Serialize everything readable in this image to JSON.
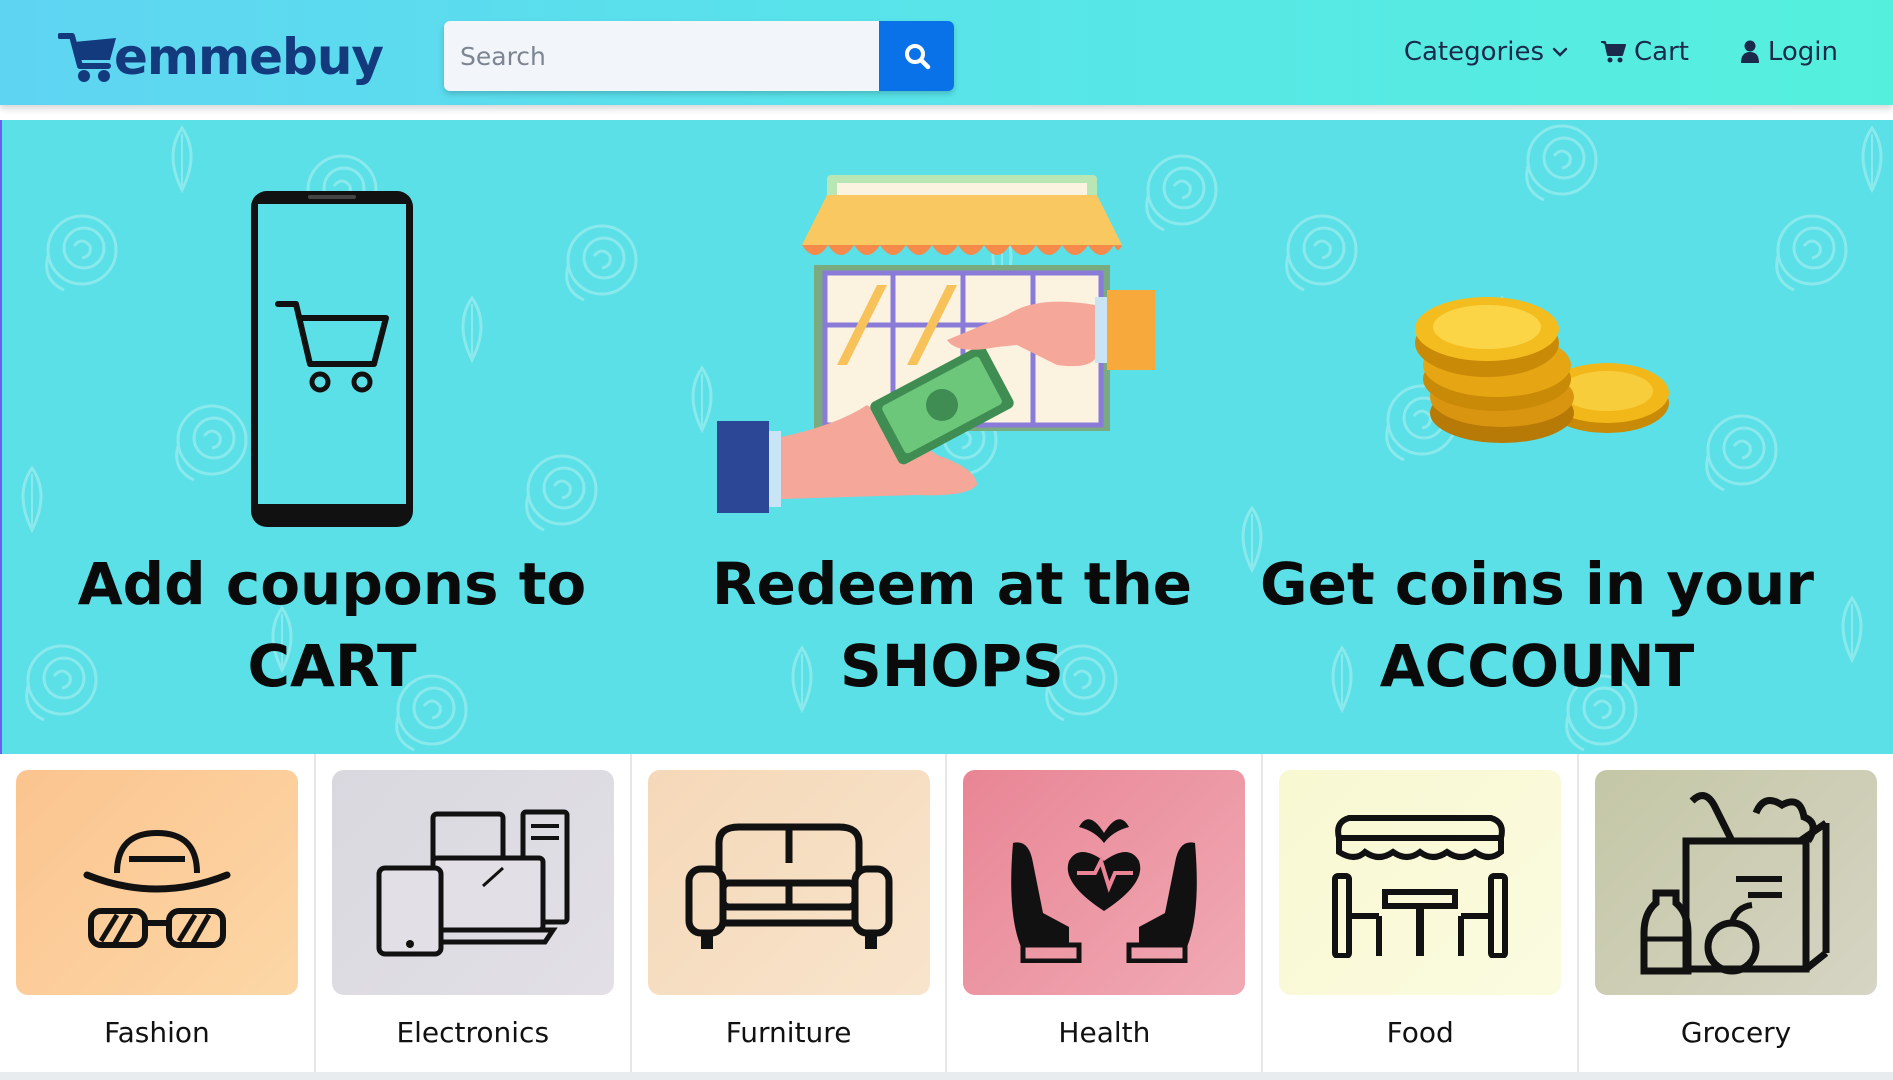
{
  "brand": {
    "name": "emmebuy",
    "primary_color": "#143a7e"
  },
  "search": {
    "placeholder": "Search",
    "value": "",
    "button_icon": "search-icon"
  },
  "nav": {
    "categories_label": "Categories",
    "cart_label": "Cart",
    "login_label": "Login"
  },
  "hero": {
    "steps": [
      {
        "line1": "Add coupons to",
        "line2": "CART",
        "icon": "phone-cart-icon"
      },
      {
        "line1": "Redeem at the",
        "line2": "SHOPS",
        "icon": "shop-payment-icon"
      },
      {
        "line1": "Get coins in your",
        "line2": "ACCOUNT",
        "icon": "gold-coins-icon"
      }
    ],
    "background_color": "#5ae0e6"
  },
  "categories": [
    {
      "label": "Fashion",
      "icon": "hat-glasses-icon",
      "bg": "#fbcf9a"
    },
    {
      "label": "Electronics",
      "icon": "devices-icon",
      "bg": "#dcdcde"
    },
    {
      "label": "Furniture",
      "icon": "sofa-icon",
      "bg": "#f6dcc0"
    },
    {
      "label": "Health",
      "icon": "heart-hands-icon",
      "bg": "#ec98a4"
    },
    {
      "label": "Food",
      "icon": "cafe-table-icon",
      "bg": "#f9f9d6"
    },
    {
      "label": "Grocery",
      "icon": "grocery-bag-icon",
      "bg": "#c9c9b0"
    }
  ]
}
